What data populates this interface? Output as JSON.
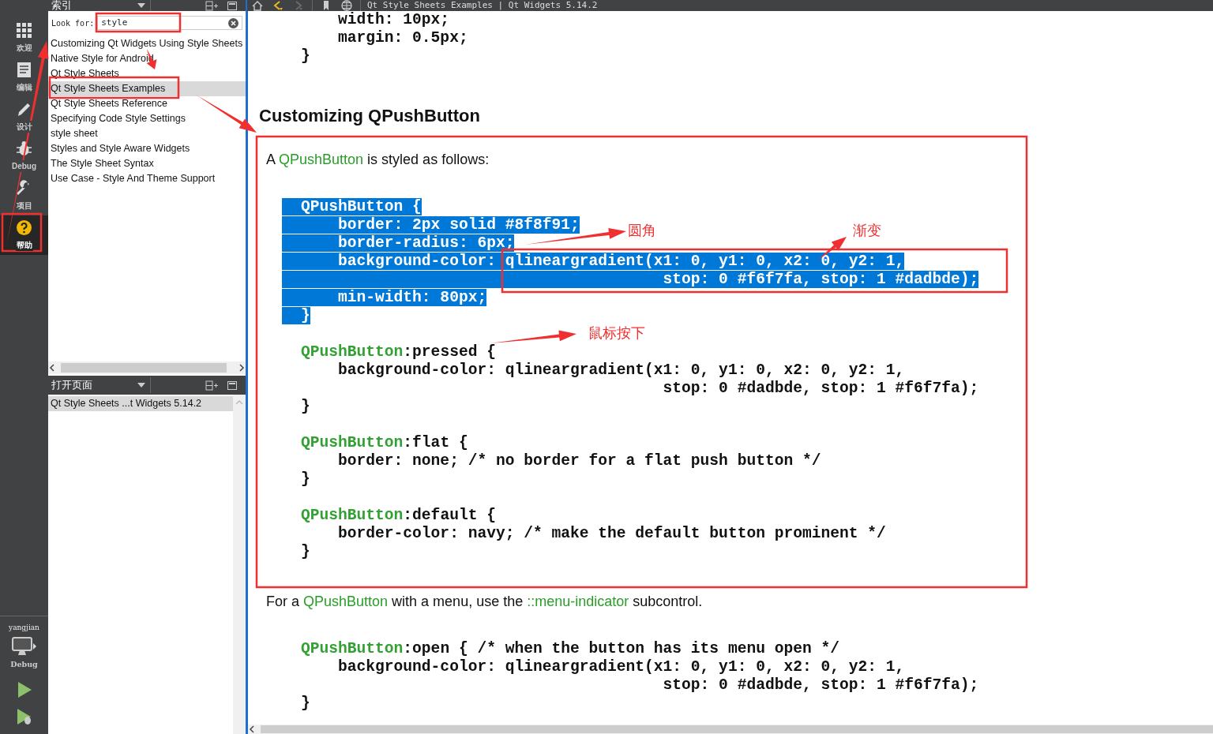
{
  "activity_bar": {
    "modes": [
      {
        "label": "欢迎",
        "kind": "welcome",
        "selected": false
      },
      {
        "label": "编辑",
        "kind": "edit",
        "selected": false
      },
      {
        "label": "设计",
        "kind": "design",
        "selected": false
      },
      {
        "label": "Debug",
        "kind": "debug",
        "selected": false
      },
      {
        "label": "项目",
        "kind": "projects",
        "selected": false
      },
      {
        "label": "帮助",
        "kind": "help",
        "selected": true
      }
    ],
    "kit": {
      "project": "yangjian",
      "build": "Debug"
    }
  },
  "sidebar": {
    "index": {
      "title": "索引",
      "look_for_label": "Look for:",
      "search_value": "style",
      "items": [
        {
          "label": "Customizing Qt Widgets Using Style Sheets",
          "selected": false
        },
        {
          "label": "Native Style for Android",
          "selected": false
        },
        {
          "label": "Qt Style Sheets",
          "selected": false
        },
        {
          "label": "Qt Style Sheets Examples",
          "selected": true
        },
        {
          "label": "Qt Style Sheets Reference",
          "selected": false
        },
        {
          "label": "Specifying Code Style Settings",
          "selected": false
        },
        {
          "label": "style sheet",
          "selected": false
        },
        {
          "label": "Styles and Style Aware Widgets",
          "selected": false
        },
        {
          "label": "The Style Sheet Syntax",
          "selected": false
        },
        {
          "label": "Use Case - Style And Theme Support",
          "selected": false
        }
      ]
    },
    "open_pages": {
      "title": "打开页面",
      "items": [
        {
          "label": "Qt Style Sheets ...t Widgets 5.14.2",
          "selected": true
        }
      ]
    }
  },
  "toolbar": {
    "buttons": [
      {
        "kind": "home",
        "disabled": false
      },
      {
        "kind": "back",
        "disabled": false
      },
      {
        "kind": "forward",
        "disabled": true
      },
      {
        "kind": "bookmark",
        "disabled": false
      },
      {
        "kind": "globe",
        "disabled": false
      }
    ],
    "title": "Qt Style Sheets Examples | Qt Widgets 5.14.2"
  },
  "document": {
    "blocks": [
      {
        "kind": "code",
        "lines": [
          {
            "text": "    width: 10px;",
            "selected": false
          },
          {
            "text": "    margin: 0.5px;",
            "selected": false
          },
          {
            "text": "}",
            "selected": false
          }
        ]
      },
      {
        "kind": "heading",
        "text": "Customizing QPushButton"
      },
      {
        "kind": "paragraph",
        "parts": [
          {
            "text": "A ",
            "link": false
          },
          {
            "text": "QPushButton",
            "link": true
          },
          {
            "text": " is styled as follows:",
            "link": false
          }
        ]
      },
      {
        "kind": "code",
        "lines": [
          {
            "selector": "QPushButton",
            "text": " {",
            "selected": true
          },
          {
            "text": "    border: 2px solid #8f8f91;",
            "selected": true
          },
          {
            "text": "    border-radius: 6px;",
            "selected": true
          },
          {
            "text": "    background-color: qlineargradient(x1: 0, y1: 0, x2: 0, y2: 1,",
            "selected": true
          },
          {
            "text": "                                       stop: 0 #f6f7fa, stop: 1 #dadbde);",
            "selected": true
          },
          {
            "text": "    min-width: 80px;",
            "selected": true
          },
          {
            "text": "}",
            "selected": true
          }
        ]
      },
      {
        "kind": "code",
        "lines": [
          {
            "selector": "QPushButton",
            "text": ":pressed {",
            "selected": false
          },
          {
            "text": "    background-color: qlineargradient(x1: 0, y1: 0, x2: 0, y2: 1,",
            "selected": false
          },
          {
            "text": "                                       stop: 0 #dadbde, stop: 1 #f6f7fa);",
            "selected": false
          },
          {
            "text": "}",
            "selected": false
          }
        ]
      },
      {
        "kind": "code",
        "lines": [
          {
            "selector": "QPushButton",
            "text": ":flat {",
            "selected": false
          },
          {
            "text": "    border: none; /* no border for a flat push button */",
            "selected": false
          },
          {
            "text": "}",
            "selected": false
          }
        ]
      },
      {
        "kind": "code",
        "lines": [
          {
            "selector": "QPushButton",
            "text": ":default {",
            "selected": false
          },
          {
            "text": "    border-color: navy; /* make the default button prominent */",
            "selected": false
          },
          {
            "text": "}",
            "selected": false
          }
        ]
      },
      {
        "kind": "paragraph",
        "parts": [
          {
            "text": "For a ",
            "link": false
          },
          {
            "text": "QPushButton",
            "link": true
          },
          {
            "text": " with a menu, use the ",
            "link": false
          },
          {
            "text": "::menu-indicator",
            "link": true
          },
          {
            "text": " subcontrol.",
            "link": false
          }
        ]
      },
      {
        "kind": "code",
        "lines": [
          {
            "selector": "QPushButton",
            "text": ":open { /* when the button has its menu open */",
            "selected": false
          },
          {
            "text": "    background-color: qlineargradient(x1: 0, y1: 0, x2: 0, y2: 1,",
            "selected": false
          },
          {
            "text": "                                       stop: 0 #dadbde, stop: 1 #f6f7fa);",
            "selected": false
          },
          {
            "text": "}",
            "selected": false
          }
        ]
      }
    ]
  },
  "annotations": [
    {
      "text": "圆角"
    },
    {
      "text": "渐变"
    },
    {
      "text": "鼠标按下"
    }
  ]
}
